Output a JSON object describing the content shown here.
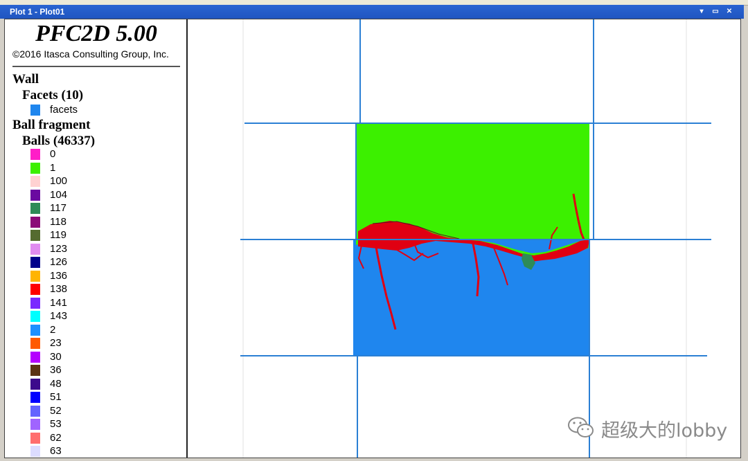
{
  "window": {
    "title": "Plot 1 - Plot01",
    "buttons": {
      "menu": "▾",
      "restore": "▭",
      "close": "✕"
    }
  },
  "legend": {
    "brand": "PFC2D 5.00",
    "copyright": "©2016 Itasca Consulting Group, Inc.",
    "wall_header": "Wall",
    "facets_header": "Facets (10)",
    "facets_item": {
      "label": "facets",
      "color": "#1f86ee"
    },
    "ball_header": "Ball fragment",
    "balls_header": "Balls (46337)",
    "groups": [
      {
        "label": "0",
        "color": "#ff1ec8"
      },
      {
        "label": "1",
        "color": "#3cf000"
      },
      {
        "label": "100",
        "color": "#ffd2d2"
      },
      {
        "label": "104",
        "color": "#6a0aa0"
      },
      {
        "label": "117",
        "color": "#2e8b57"
      },
      {
        "label": "118",
        "color": "#8b0a78"
      },
      {
        "label": "119",
        "color": "#556b2f"
      },
      {
        "label": "123",
        "color": "#e08cf0"
      },
      {
        "label": "126",
        "color": "#00008b"
      },
      {
        "label": "136",
        "color": "#ffb400"
      },
      {
        "label": "138",
        "color": "#ff0000"
      },
      {
        "label": "141",
        "color": "#7a28ff"
      },
      {
        "label": "143",
        "color": "#00ffff"
      },
      {
        "label": "2",
        "color": "#1e90ff"
      },
      {
        "label": "23",
        "color": "#ff5a00"
      },
      {
        "label": "30",
        "color": "#b400ff"
      },
      {
        "label": "36",
        "color": "#5a3214"
      },
      {
        "label": "48",
        "color": "#3c0a8c"
      },
      {
        "label": "51",
        "color": "#0000ff"
      },
      {
        "label": "52",
        "color": "#6464ff"
      },
      {
        "label": "53",
        "color": "#a064ff"
      },
      {
        "label": "62",
        "color": "#ff6e6e"
      },
      {
        "label": "63",
        "color": "#dcdcff"
      }
    ]
  },
  "colors": {
    "wall_line": "#2a7fd4",
    "upper_block": "#3cf000",
    "lower_block": "#1f86ee",
    "fracture": "#e00012",
    "group_117": "#2e8b57"
  },
  "watermark": {
    "text": "超级大的lobby",
    "icon": "wechat-icon"
  }
}
